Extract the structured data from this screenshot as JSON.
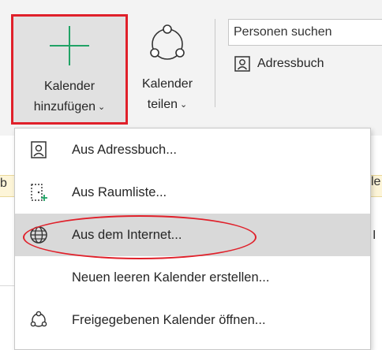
{
  "ribbon": {
    "add_calendar": {
      "line1": "Kalender",
      "line2": "hinzufügen"
    },
    "share_calendar": {
      "line1": "Kalender",
      "line2": "teilen"
    },
    "search": {
      "value": "Personen suchen"
    },
    "address_book": {
      "label": "Adressbuch"
    },
    "chevron": "⌄"
  },
  "menu": {
    "items": [
      {
        "label": "Aus Adressbuch...",
        "icon": "address-book-icon"
      },
      {
        "label": "Aus Raumliste...",
        "icon": "room-list-icon"
      },
      {
        "label": "Aus dem Internet...",
        "icon": "globe-icon"
      },
      {
        "label": "Neuen leeren Kalender erstellen...",
        "icon": ""
      },
      {
        "label": "Freigegebenen Kalender öffnen...",
        "icon": "shared-calendar-icon"
      }
    ]
  },
  "background": {
    "left_fragment": "b",
    "right_fragment": "le",
    "right_fragment2": "I"
  },
  "colors": {
    "highlight_red": "#e0202a",
    "accent_green": "#21a366",
    "hover_gray": "#d9d9d9"
  }
}
